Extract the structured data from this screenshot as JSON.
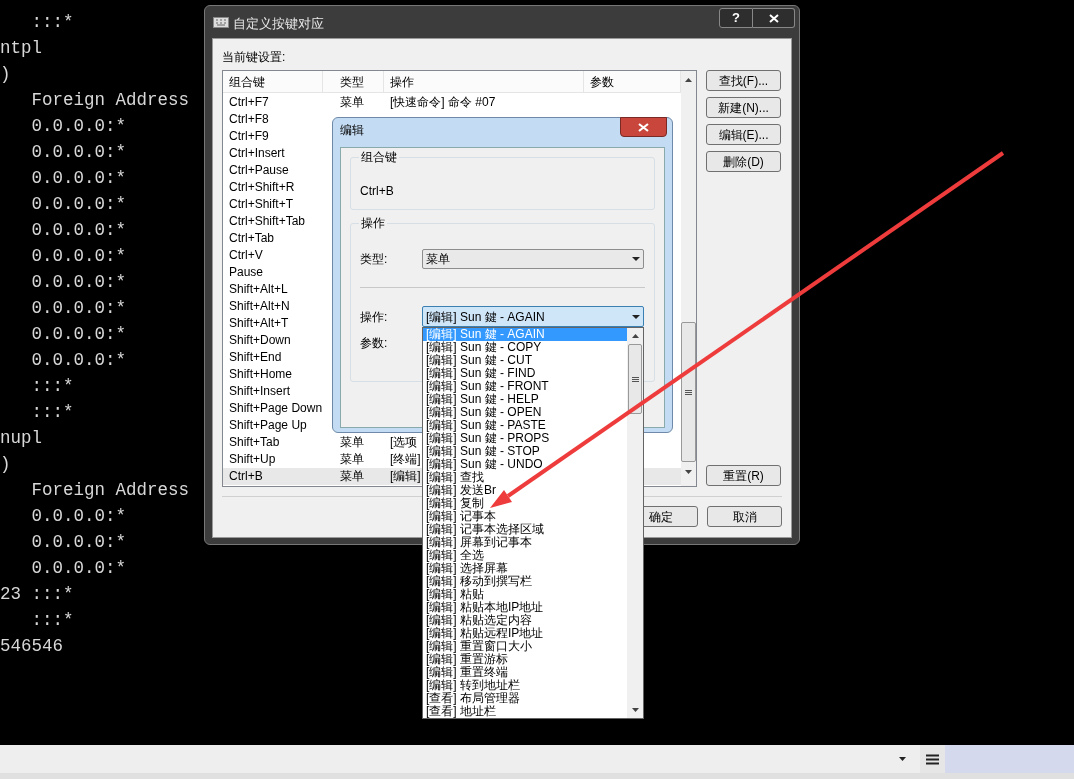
{
  "terminal": {
    "lines": [
      "   :::*",
      "ntpl",
      ")",
      "   Foreign Address",
      "   0.0.0.0:*",
      "   0.0.0.0:*",
      "   0.0.0.0:*",
      "   0.0.0.0:*",
      "   0.0.0.0:*",
      "   0.0.0.0:*",
      "   0.0.0.0:*",
      "   0.0.0.0:*",
      "   0.0.0.0:*",
      "   0.0.0.0:*",
      "   :::*",
      "   :::*",
      "nupl",
      ")",
      "   Foreign Address",
      "   0.0.0.0:*",
      "   0.0.0.0:*",
      "   0.0.0.0:*",
      "23 :::*",
      "   :::*",
      "546546"
    ]
  },
  "main_dialog": {
    "title": "自定义按键对应",
    "help_button": "?",
    "section_label": "当前键设置:",
    "columns": [
      "组合键",
      "类型",
      "操作",
      "参数"
    ],
    "rows": [
      {
        "key": "Ctrl+F7",
        "type": "菜单",
        "action": "[快速命令] 命令 #07",
        "selected": false
      },
      {
        "key": "Ctrl+F8",
        "selected": false
      },
      {
        "key": "Ctrl+F9",
        "selected": false
      },
      {
        "key": "Ctrl+Insert",
        "selected": false
      },
      {
        "key": "Ctrl+Pause",
        "selected": false
      },
      {
        "key": "Ctrl+Shift+R",
        "selected": false
      },
      {
        "key": "Ctrl+Shift+T",
        "selected": false
      },
      {
        "key": "Ctrl+Shift+Tab",
        "selected": false
      },
      {
        "key": "Ctrl+Tab",
        "selected": false
      },
      {
        "key": "Ctrl+V",
        "selected": false
      },
      {
        "key": "Pause",
        "selected": false
      },
      {
        "key": "Shift+Alt+L",
        "selected": false
      },
      {
        "key": "Shift+Alt+N",
        "selected": false
      },
      {
        "key": "Shift+Alt+T",
        "selected": false
      },
      {
        "key": "Shift+Down",
        "selected": false
      },
      {
        "key": "Shift+End",
        "selected": false
      },
      {
        "key": "Shift+Home",
        "selected": false
      },
      {
        "key": "Shift+Insert",
        "selected": false
      },
      {
        "key": "Shift+Page Down",
        "selected": false
      },
      {
        "key": "Shift+Page Up",
        "selected": false
      },
      {
        "key": "Shift+Tab",
        "type": "菜单",
        "action": "[选项",
        "selected": false
      },
      {
        "key": "Shift+Up",
        "type": "菜单",
        "action": "[终端]",
        "selected": false
      },
      {
        "key": "Ctrl+B",
        "type": "菜单",
        "action": "[编辑]",
        "selected": true
      }
    ],
    "side_buttons": [
      "查找(F)...",
      "新建(N)...",
      "编辑(E)...",
      "删除(D)"
    ],
    "reset_button": "重置(R)",
    "ok_button": "确定",
    "cancel_button": "取消"
  },
  "edit_dialog": {
    "title": "编辑",
    "key_group": {
      "title": "组合键",
      "value": "Ctrl+B"
    },
    "action_group": {
      "title": "操作",
      "type_label": "类型:",
      "type_value": "菜单",
      "action_label": "操作:",
      "action_value": "[编辑] Sun 鍵 - AGAIN",
      "param_label": "参数:"
    },
    "dropdown": {
      "items": [
        {
          "label": "[编辑] Sun 鍵 - AGAIN",
          "selected": true
        },
        {
          "label": "[编辑] Sun 鍵 - COPY",
          "selected": false
        },
        {
          "label": "[编辑] Sun 鍵 - CUT",
          "selected": false
        },
        {
          "label": "[编辑] Sun 鍵 - FIND",
          "selected": false
        },
        {
          "label": "[编辑] Sun 鍵 - FRONT",
          "selected": false
        },
        {
          "label": "[编辑] Sun 鍵 - HELP",
          "selected": false
        },
        {
          "label": "[编辑] Sun 鍵 - OPEN",
          "selected": false
        },
        {
          "label": "[编辑] Sun 鍵 - PASTE",
          "selected": false
        },
        {
          "label": "[编辑] Sun 鍵 - PROPS",
          "selected": false
        },
        {
          "label": "[编辑] Sun 鍵 - STOP",
          "selected": false
        },
        {
          "label": "[编辑] Sun 鍵 - UNDO",
          "selected": false
        },
        {
          "label": "[编辑] 查找",
          "selected": false
        },
        {
          "label": "[编辑] 发送Br",
          "selected": false
        },
        {
          "label": "[编辑] 复制",
          "selected": false
        },
        {
          "label": "[编辑] 记事本",
          "selected": false
        },
        {
          "label": "[编辑] 记事本选择区域",
          "selected": false
        },
        {
          "label": "[编辑] 屏幕到记事本",
          "selected": false
        },
        {
          "label": "[编辑] 全选",
          "selected": false
        },
        {
          "label": "[编辑] 选择屏幕",
          "selected": false
        },
        {
          "label": "[编辑] 移动到撰写栏",
          "selected": false
        },
        {
          "label": "[编辑] 粘贴",
          "selected": false
        },
        {
          "label": "[编辑] 粘贴本地IP地址",
          "selected": false
        },
        {
          "label": "[编辑] 粘贴选定内容",
          "selected": false
        },
        {
          "label": "[编辑] 粘贴远程IP地址",
          "selected": false
        },
        {
          "label": "[编辑] 重置窗口大小",
          "selected": false
        },
        {
          "label": "[编辑] 重置游标",
          "selected": false
        },
        {
          "label": "[编辑] 重置终端",
          "selected": false
        },
        {
          "label": "[编辑] 转到地址栏",
          "selected": false
        },
        {
          "label": "[查看] 布局管理器",
          "selected": false
        },
        {
          "label": "[查看] 地址栏",
          "selected": false
        }
      ]
    }
  }
}
